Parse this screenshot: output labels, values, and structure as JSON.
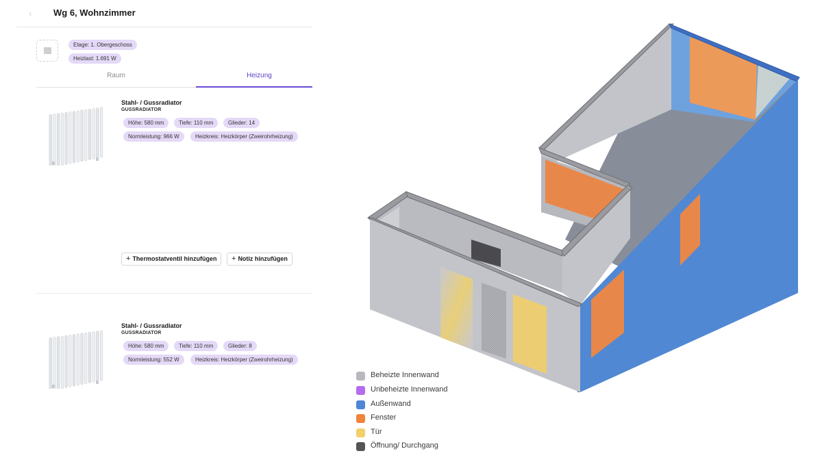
{
  "header": {
    "title": "Wg 6, Wohnzimmer"
  },
  "room": {
    "pills": [
      "Etage: 1. Obergeschoss",
      "Heizlast: 1.691 W"
    ]
  },
  "tabs": [
    {
      "label": "Raum",
      "active": false
    },
    {
      "label": "Heizung",
      "active": true
    }
  ],
  "radiators": [
    {
      "title": "Stahl- / Gussradiator",
      "subtitle": "GUSSRADIATOR",
      "specs": [
        "Höhe: 580 mm",
        "Tiefe: 110 mm",
        "Glieder: 14"
      ],
      "specs2": [
        "Normleistung: 966 W",
        "Heizkreis: Heizkörper (Zweirohrheizung)"
      ],
      "actions": [
        "Thermostatventil hinzufügen",
        "Notiz hinzufügen"
      ]
    },
    {
      "title": "Stahl- / Gussradiator",
      "subtitle": "GUSSRADIATOR",
      "specs": [
        "Höhe: 580 mm",
        "Tiefe: 110 mm",
        "Glieder: 8"
      ],
      "specs2": [
        "Normleistung: 552 W",
        "Heizkreis: Heizkörper (Zweirohrheizung)"
      ]
    }
  ],
  "legend": [
    {
      "label": "Beheizte Innenwand",
      "color": "#b8b9be"
    },
    {
      "label": "Unbeheizte Innenwand",
      "color": "#b36bf0"
    },
    {
      "label": "Außenwand",
      "color": "#4f86d6"
    },
    {
      "label": "Fenster",
      "color": "#f0843c"
    },
    {
      "label": "Tür",
      "color": "#f2cf6a"
    },
    {
      "label": "Öffnung/ Durchgang",
      "color": "#555555"
    }
  ],
  "colors": {
    "accent": "#6a4bd6",
    "pill_bg": "#e4d9f7",
    "inner_wall": "#c3c4c9",
    "outer_wall": "#4f86d6",
    "window": "#e8874a",
    "door": "#eccd72",
    "floor": "#878e9a"
  }
}
